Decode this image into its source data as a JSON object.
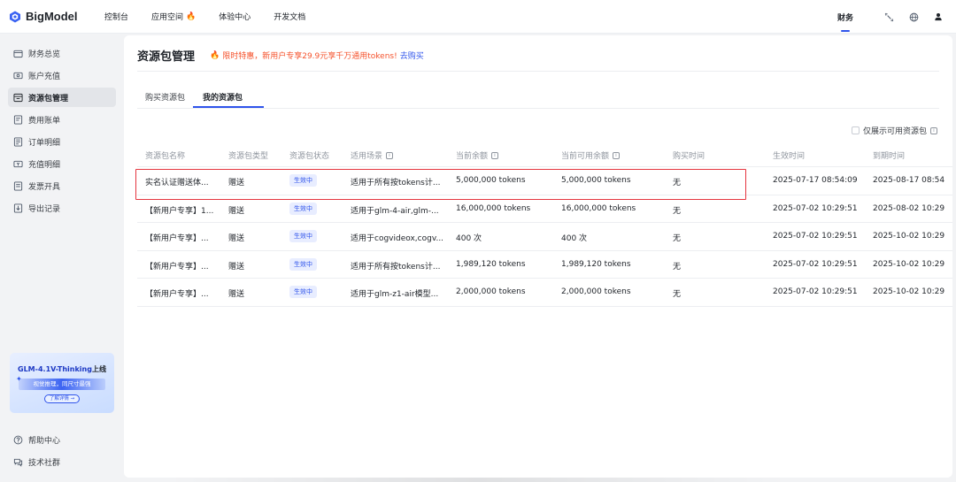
{
  "topnav": {
    "brand": "BigModel",
    "items": [
      {
        "label": "控制台"
      },
      {
        "label": "应用空间"
      },
      {
        "label": "体验中心"
      },
      {
        "label": "开发文档"
      }
    ],
    "right_label": "财务"
  },
  "sidebar": {
    "items": [
      {
        "label": "财务总览"
      },
      {
        "label": "账户充值"
      },
      {
        "label": "资源包管理"
      },
      {
        "label": "费用账单"
      },
      {
        "label": "订单明细"
      },
      {
        "label": "充值明细"
      },
      {
        "label": "发票开具"
      },
      {
        "label": "导出记录"
      }
    ],
    "bottom_items": [
      {
        "label": "帮助中心"
      },
      {
        "label": "技术社群"
      }
    ],
    "promo": {
      "title": "GLM-4.1V-Thinking",
      "title_suffix": "上线",
      "band": "视觉推理，同尺寸最强",
      "button": "了解详情 →"
    }
  },
  "main": {
    "title": "资源包管理",
    "promo_text": "限时特惠，新用户专享29.9元享千万通用tokens!",
    "promo_link": "去购买",
    "tabs": [
      {
        "label": "购买资源包"
      },
      {
        "label": "我的资源包"
      }
    ],
    "filter_label": "仅展示可用资源包",
    "columns": [
      {
        "label": "资源包名称"
      },
      {
        "label": "资源包类型"
      },
      {
        "label": "资源包状态"
      },
      {
        "label": "适用场景"
      },
      {
        "label": "当前余额"
      },
      {
        "label": "当前可用余额"
      },
      {
        "label": "购买时间"
      },
      {
        "label": "生效时间"
      },
      {
        "label": "到期时间"
      }
    ],
    "rows": [
      {
        "name": "实名认证赠送体...",
        "type": "赠送",
        "status": "生效中",
        "scene": "适用于所有按tokens计...",
        "balance": "5,000,000 tokens",
        "available": "5,000,000 tokens",
        "purchase": "无",
        "start": "2025-07-17 08:54:09",
        "end": "2025-08-17 08:54"
      },
      {
        "name": "【新用户专享】1...",
        "type": "赠送",
        "status": "生效中",
        "scene": "适用于glm-4-air,glm-...",
        "balance": "16,000,000 tokens",
        "available": "16,000,000 tokens",
        "purchase": "无",
        "start": "2025-07-02 10:29:51",
        "end": "2025-08-02 10:29"
      },
      {
        "name": "【新用户专享】...",
        "type": "赠送",
        "status": "生效中",
        "scene": "适用于cogvideox,cogv...",
        "balance": "400 次",
        "available": "400 次",
        "purchase": "无",
        "start": "2025-07-02 10:29:51",
        "end": "2025-10-02 10:29"
      },
      {
        "name": "【新用户专享】...",
        "type": "赠送",
        "status": "生效中",
        "scene": "适用于所有按tokens计...",
        "balance": "1,989,120 tokens",
        "available": "1,989,120 tokens",
        "purchase": "无",
        "start": "2025-07-02 10:29:51",
        "end": "2025-10-02 10:29"
      },
      {
        "name": "【新用户专享】...",
        "type": "赠送",
        "status": "生效中",
        "scene": "适用于glm-z1-air模型...",
        "balance": "2,000,000 tokens",
        "available": "2,000,000 tokens",
        "purchase": "无",
        "start": "2025-07-02 10:29:51",
        "end": "2025-10-02 10:29"
      }
    ]
  },
  "colors": {
    "accent": "#2f54eb",
    "promo": "#f5532d",
    "highlight": "#e5353f"
  }
}
